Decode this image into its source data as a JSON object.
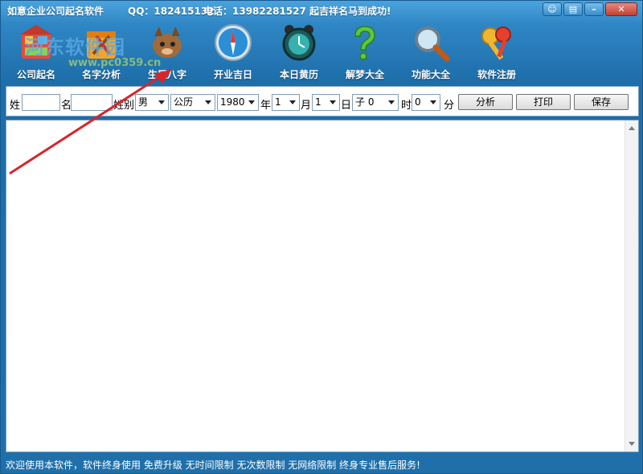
{
  "title": {
    "app_name": "如意企业公司起名软件",
    "qq": "QQ：182415132",
    "phone": "电话：13982281527 起吉祥名马到成功!"
  },
  "watermark": {
    "text": "河东软件园",
    "url": "www.pc0359.cn"
  },
  "toolbar": [
    {
      "label": "公司起名",
      "icon": "company-naming-icon"
    },
    {
      "label": "名字分析",
      "icon": "name-analysis-icon"
    },
    {
      "label": "生辰八字",
      "icon": "birth-chart-icon"
    },
    {
      "label": "开业吉日",
      "icon": "compass-icon"
    },
    {
      "label": "本日黄历",
      "icon": "alarm-clock-icon"
    },
    {
      "label": "解梦大全",
      "icon": "question-mark-icon"
    },
    {
      "label": "功能大全",
      "icon": "magnifier-icon"
    },
    {
      "label": "软件注册",
      "icon": "keys-icon"
    }
  ],
  "form": {
    "surname_label": "姓",
    "name_label": "名",
    "gender_label": "姓别",
    "gender_value": "男",
    "calendar_value": "公历",
    "year_value": "1980",
    "year_label": "年",
    "month_value": "1",
    "month_label": "月",
    "day_value": "1",
    "day_label": "日",
    "hour_value": "子 0",
    "hour_label": "时",
    "minute_value": "0",
    "minute_label": "分",
    "analyze_button": "分析",
    "print_button": "打印",
    "save_button": "保存"
  },
  "statusbar": {
    "text": "欢迎使用本软件，软件终身使用  免费升级  无时间限制  无次数限制  无网络限制  终身专业售后服务!"
  },
  "colors": {
    "window_bg": "#2f86c4",
    "arrow": "#d9242b"
  }
}
